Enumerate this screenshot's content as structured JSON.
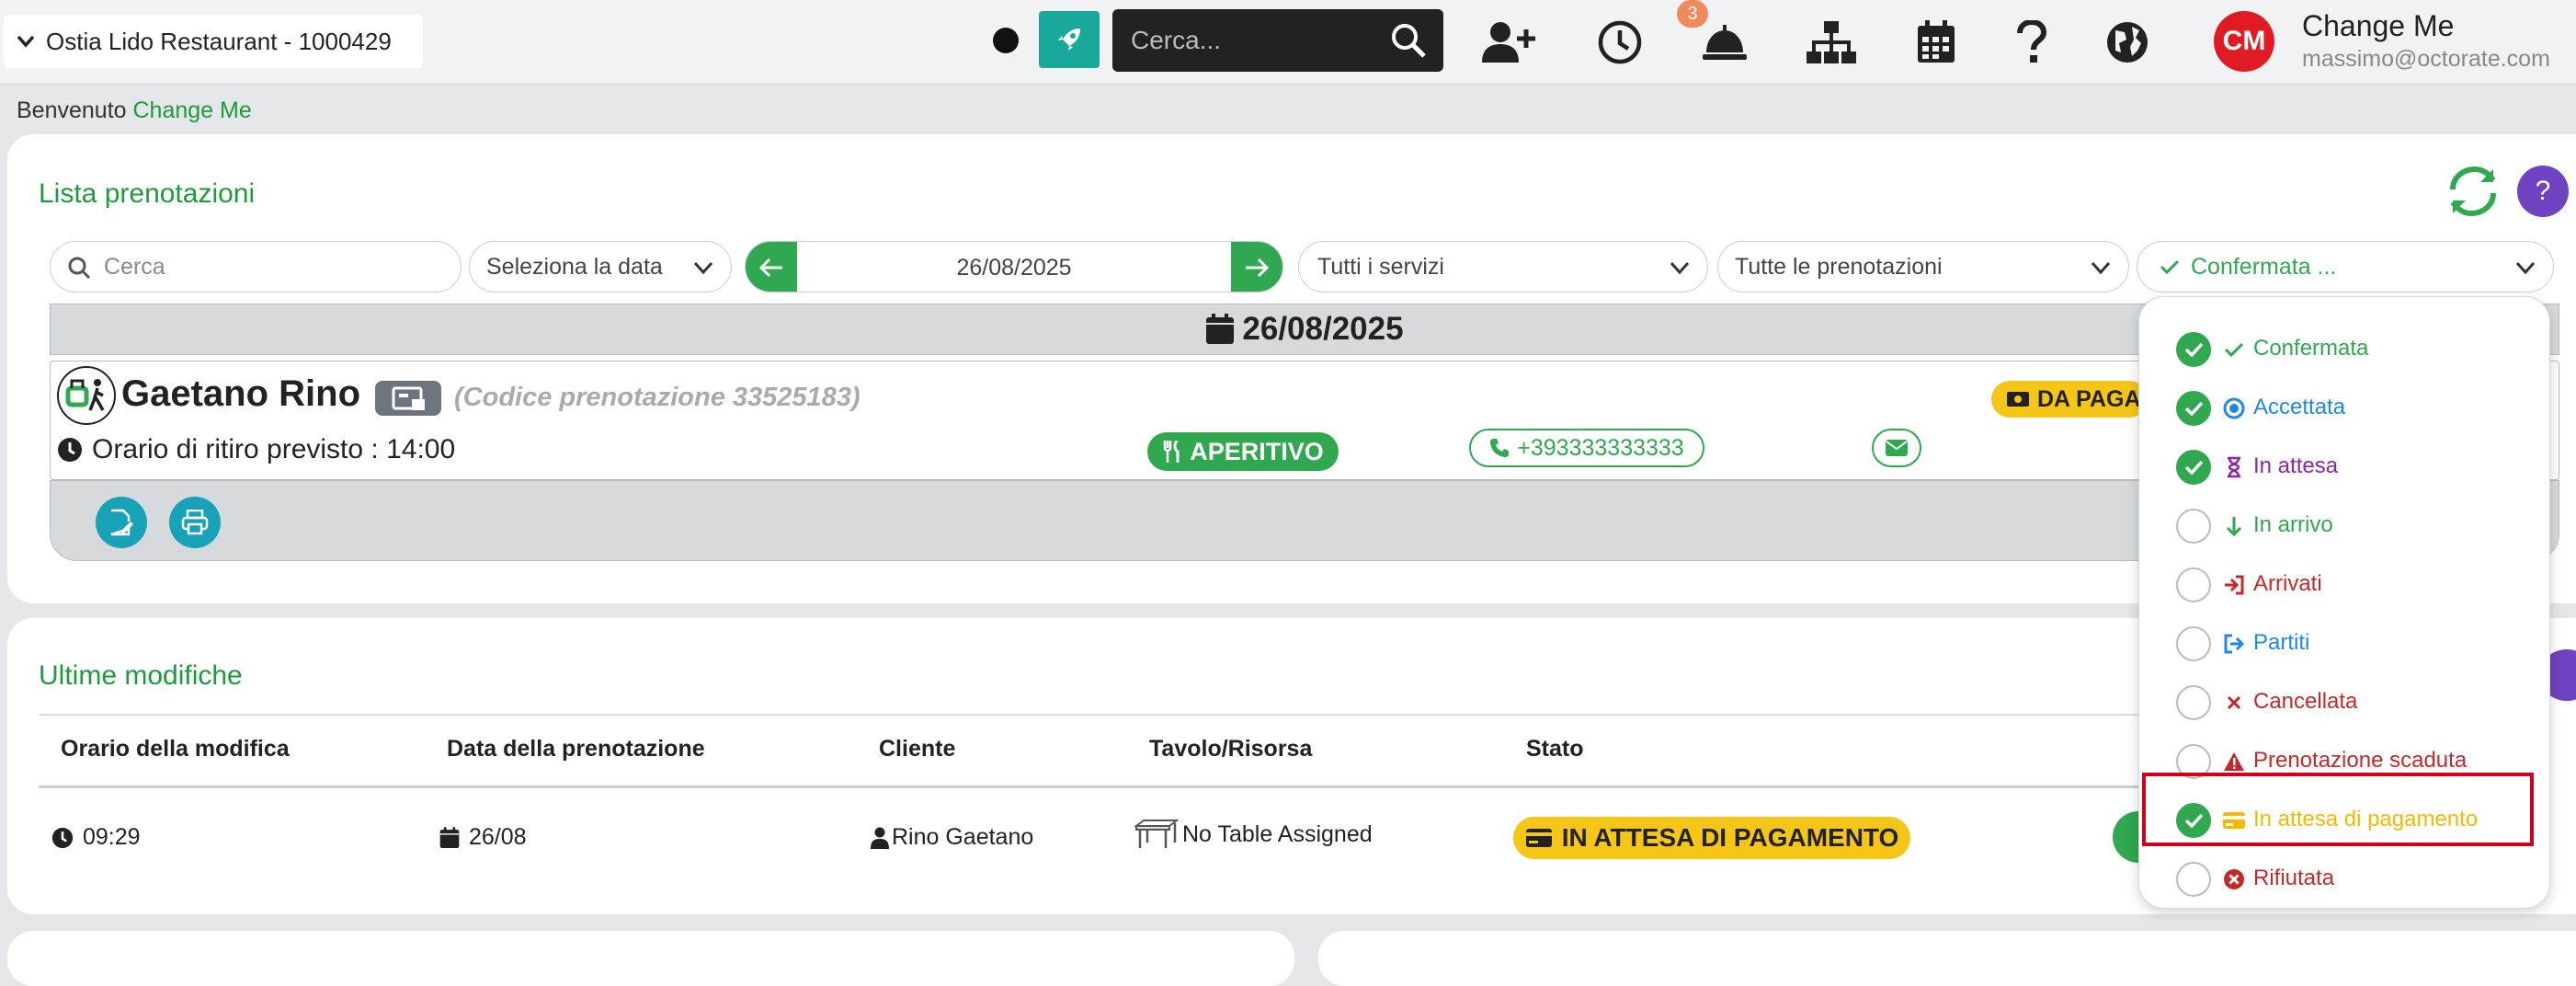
{
  "header": {
    "restaurant": "Ostia Lido Restaurant - 1000429",
    "search_placeholder": "Cerca...",
    "notification_count": "3",
    "avatar_initials": "CM",
    "user_name": "Change Me",
    "user_email": "massimo@octorate.com"
  },
  "welcome": {
    "prefix": "Benvenuto",
    "name": "Change Me"
  },
  "reservations": {
    "title": "Lista prenotazioni",
    "filters": {
      "search_placeholder": "Cerca",
      "date_select": "Seleziona la data",
      "date": "26/08/2025",
      "services": "Tutti i servizi",
      "bookings": "Tutte le prenotazioni",
      "status": "Confermata ..."
    },
    "day_header": "26/08/2025",
    "item": {
      "name": "Gaetano Rino",
      "code": "(Codice prenotazione 33525183)",
      "pickup": "Orario di ritiro previsto : 14:00",
      "service": "APERITIVO",
      "phone": "+393333333333",
      "payment_badge": "DA PAGA"
    }
  },
  "changes": {
    "title": "Ultime modifiche",
    "columns": [
      "Orario della modifica",
      "Data della prenotazione",
      "Cliente",
      "Tavolo/Risorsa",
      "Stato"
    ],
    "row": {
      "time": "09:29",
      "date": "26/08",
      "client": "Rino Gaetano",
      "table": "No Table Assigned",
      "status": "IN ATTESA DI PAGAMENTO"
    }
  },
  "status_dropdown": {
    "options": [
      {
        "label": "Confermata",
        "checked": true,
        "color": "#2fa84f",
        "icon": "check-icon"
      },
      {
        "label": "Accettata",
        "checked": true,
        "color": "#1e88e5",
        "icon": "dot-circle-icon"
      },
      {
        "label": "In attesa",
        "checked": true,
        "color": "#8e24aa",
        "icon": "hourglass-icon"
      },
      {
        "label": "In arrivo",
        "checked": false,
        "color": "#2fa84f",
        "icon": "arrow-down-icon"
      },
      {
        "label": "Arrivati",
        "checked": false,
        "color": "#c62828",
        "icon": "sign-in-icon"
      },
      {
        "label": "Partiti",
        "checked": false,
        "color": "#1e88e5",
        "icon": "sign-out-icon"
      },
      {
        "label": "Cancellata",
        "checked": false,
        "color": "#c62828",
        "icon": "times-icon"
      },
      {
        "label": "Prenotazione scaduta",
        "checked": false,
        "color": "#c62828",
        "icon": "warning-icon"
      },
      {
        "label": "In attesa di pagamento",
        "checked": true,
        "color": "#f5b800",
        "icon": "credit-card-icon"
      },
      {
        "label": "Rifiutata",
        "checked": false,
        "color": "#c62828",
        "icon": "times-circle-icon"
      }
    ]
  }
}
